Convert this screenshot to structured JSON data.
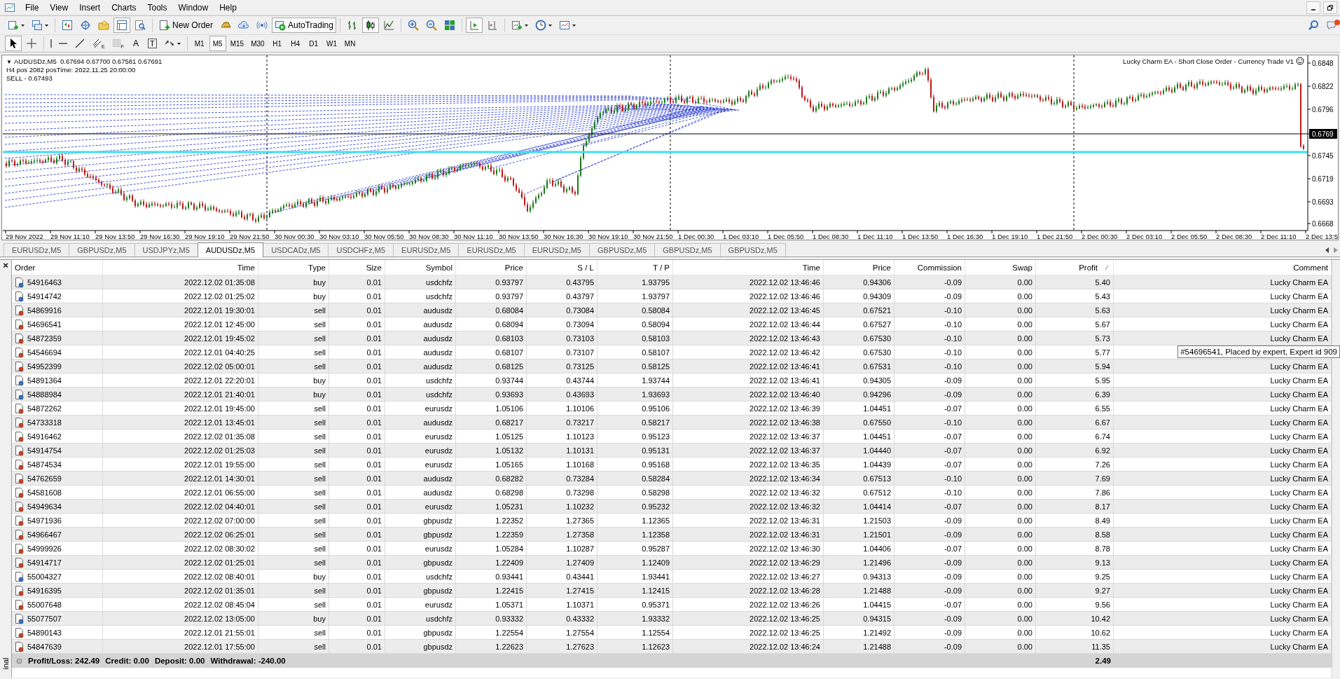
{
  "menu": {
    "items": [
      "File",
      "View",
      "Insert",
      "Charts",
      "Tools",
      "Window",
      "Help"
    ]
  },
  "toolbar": {
    "buttons": [
      {
        "pressed": false
      },
      {
        "pressed": false
      },
      {
        "pressed": false
      },
      {
        "pressed": false
      },
      {
        "pressed": false
      },
      {
        "pressed": true
      },
      {
        "pressed": false
      },
      {
        "label": "New Order",
        "pressed": false
      },
      {
        "pressed": false
      },
      {
        "pressed": false
      },
      {
        "pressed": false
      },
      {
        "label": "AutoTrading",
        "pressed": true
      },
      {
        "pressed": false
      },
      {
        "pressed": true
      },
      {
        "pressed": false
      },
      {
        "pressed": false
      },
      {
        "pressed": false
      },
      {
        "pressed": false
      },
      {
        "pressed": true
      },
      {
        "pressed": false
      },
      {
        "pressed": false
      },
      {
        "pressed": false
      },
      {
        "pressed": false
      }
    ]
  },
  "drawing_toolbar": {
    "tools": [
      {
        "pressed": true
      },
      {
        "pressed": false
      },
      {
        "pressed": false
      },
      {
        "pressed": false
      },
      {
        "pressed": false
      },
      {
        "label": "E",
        "pressed": false
      },
      {
        "label": "F",
        "pressed": false
      },
      {
        "label": "A",
        "pressed": false
      },
      {
        "label": "T",
        "pressed": false
      },
      {
        "pressed": false
      }
    ],
    "timeframes": [
      {
        "label": "M1",
        "selected": false
      },
      {
        "label": "M5",
        "selected": true
      },
      {
        "label": "M15",
        "selected": false
      },
      {
        "label": "M30",
        "selected": false
      },
      {
        "label": "H1",
        "selected": false
      },
      {
        "label": "H4",
        "selected": false
      },
      {
        "label": "D1",
        "selected": false
      },
      {
        "label": "W1",
        "selected": false
      },
      {
        "label": "MN",
        "selected": false
      }
    ]
  },
  "chart": {
    "collapse_arrow": "▼",
    "title": "AUDUSDz,M5  0.67694 0.67700 0.67581 0.67691",
    "info_lines": [
      "H4 pos 2082 posTime: 2022.11.25 20:00:00",
      "SELL - 0.67493"
    ],
    "expert": "Lucky Charm EA - Short Close Order - Currency Trade V1",
    "price_labels": [
      {
        "text": "0.6848",
        "current": false
      },
      {
        "text": "0.6822",
        "current": false
      },
      {
        "text": "0.6796",
        "current": false
      },
      {
        "text": "0.6769",
        "current": true
      },
      {
        "text": "0.6745",
        "current": false
      },
      {
        "text": "0.6719",
        "current": false
      },
      {
        "text": "0.6693",
        "current": false
      },
      {
        "text": "0.6668",
        "current": false
      }
    ],
    "time_labels": [
      "29 Nov 2022",
      "29 Nov 11:10",
      "29 Nov 13:50",
      "29 Nov 16:30",
      "29 Nov 19:10",
      "29 Nov 21:50",
      "30 Nov 00:30",
      "30 Nov 03:10",
      "30 Nov 05:50",
      "30 Nov 08:30",
      "30 Nov 11:10",
      "30 Nov 13:50",
      "30 Nov 16:30",
      "30 Nov 19:10",
      "30 Nov 21:50",
      "1 Dec 00:30",
      "1 Dec 03:10",
      "1 Dec 05:50",
      "1 Dec 08:30",
      "1 Dec 11:10",
      "1 Dec 13:50",
      "1 Dec 16:30",
      "1 Dec 19:10",
      "1 Dec 21:50",
      "2 Dec 00:30",
      "2 Dec 03:10",
      "2 Dec 05:50",
      "2 Dec 08:30",
      "2 Dec 11:10",
      "2 Dec 13:5"
    ]
  },
  "chart_tabs": [
    {
      "label": "EURUSDz,M5",
      "selected": false
    },
    {
      "label": "GBPUSDz,M5",
      "selected": false
    },
    {
      "label": "USDJPYz,M5",
      "selected": false
    },
    {
      "label": "AUDUSDz,M5",
      "selected": true
    },
    {
      "label": "USDCADz,M5",
      "selected": false
    },
    {
      "label": "USDCHFz,M5",
      "selected": false
    },
    {
      "label": "EURUSDz,M5",
      "selected": false
    },
    {
      "label": "EURUSDz,M5",
      "selected": false
    },
    {
      "label": "EURUSDz,M5",
      "selected": false
    },
    {
      "label": "GBPUSDz,M5",
      "selected": false
    },
    {
      "label": "GBPUSDz,M5",
      "selected": false
    },
    {
      "label": "GBPUSDz,M5",
      "selected": false
    }
  ],
  "terminal": {
    "close": "×",
    "side_label": "inal",
    "columns": [
      {
        "label": "Order",
        "sorted": false
      },
      {
        "label": "Time",
        "sorted": false
      },
      {
        "label": "Type",
        "sorted": false
      },
      {
        "label": "Size",
        "sorted": false
      },
      {
        "label": "Symbol",
        "sorted": false
      },
      {
        "label": "Price",
        "sorted": false
      },
      {
        "label": "S / L",
        "sorted": false
      },
      {
        "label": "T / P",
        "sorted": false
      },
      {
        "label": "Time",
        "sorted": false
      },
      {
        "label": "Price",
        "sorted": false
      },
      {
        "label": "Commission",
        "sorted": false
      },
      {
        "label": "Swap",
        "sorted": false
      },
      {
        "label": "Profit",
        "sorted": true
      },
      {
        "label": "Comment",
        "sorted": false
      }
    ],
    "rows": [
      {
        "kind": "buy",
        "cells": [
          "54916463",
          "2022.12.02 01:35:08",
          "buy",
          "0.01",
          "usdchfz",
          "0.93797",
          "0.43795",
          "1.93795",
          "2022.12.02 13:46:46",
          "0.94306",
          "-0.09",
          "0.00",
          "5.40",
          "Lucky Charm EA"
        ]
      },
      {
        "kind": "buy",
        "cells": [
          "54914742",
          "2022.12.02 01:25:02",
          "buy",
          "0.01",
          "usdchfz",
          "0.93797",
          "0.43797",
          "1.93797",
          "2022.12.02 13:46:46",
          "0.94309",
          "-0.09",
          "0.00",
          "5.43",
          "Lucky Charm EA"
        ]
      },
      {
        "kind": "sell",
        "cells": [
          "54869916",
          "2022.12.01 19:30:01",
          "sell",
          "0.01",
          "audusdz",
          "0.68084",
          "0.73084",
          "0.58084",
          "2022.12.02 13:46:45",
          "0.67521",
          "-0.10",
          "0.00",
          "5.63",
          "Lucky Charm EA"
        ]
      },
      {
        "kind": "sell",
        "cells": [
          "54696541",
          "2022.12.01 12:45:00",
          "sell",
          "0.01",
          "audusdz",
          "0.68094",
          "0.73094",
          "0.58094",
          "2022.12.02 13:46:44",
          "0.67527",
          "-0.10",
          "0.00",
          "5.67",
          "Lucky Charm EA"
        ]
      },
      {
        "kind": "sell",
        "cells": [
          "54872359",
          "2022.12.01 19:45:02",
          "sell",
          "0.01",
          "audusdz",
          "0.68103",
          "0.73103",
          "0.58103",
          "2022.12.02 13:46:43",
          "0.67530",
          "-0.10",
          "0.00",
          "5.73",
          "Lucky Charm EA"
        ]
      },
      {
        "kind": "sell",
        "cells": [
          "54546694",
          "2022.12.01 04:40:25",
          "sell",
          "0.01",
          "audusdz",
          "0.68107",
          "0.73107",
          "0.58107",
          "2022.12.02 13:46:42",
          "0.67530",
          "-0.10",
          "0.00",
          "5.77"
        ]
      },
      {
        "kind": "sell",
        "cells": [
          "54952399",
          "2022.12.02 05:00:01",
          "sell",
          "0.01",
          "audusdz",
          "0.68125",
          "0.73125",
          "0.58125",
          "2022.12.02 13:46:41",
          "0.67531",
          "-0.10",
          "0.00",
          "5.94",
          "Lucky Charm EA"
        ]
      },
      {
        "kind": "buy",
        "cells": [
          "54891364",
          "2022.12.01 22:20:01",
          "buy",
          "0.01",
          "usdchfz",
          "0.93744",
          "0.43744",
          "1.93744",
          "2022.12.02 13:46:41",
          "0.94305",
          "-0.09",
          "0.00",
          "5.95",
          "Lucky Charm EA"
        ]
      },
      {
        "kind": "buy",
        "cells": [
          "54888984",
          "2022.12.01 21:40:01",
          "buy",
          "0.01",
          "usdchfz",
          "0.93693",
          "0.43693",
          "1.93693",
          "2022.12.02 13:46:40",
          "0.94296",
          "-0.09",
          "0.00",
          "6.39",
          "Lucky Charm EA"
        ]
      },
      {
        "kind": "sell",
        "cells": [
          "54872262",
          "2022.12.01 19:45:00",
          "sell",
          "0.01",
          "eurusdz",
          "1.05106",
          "1.10106",
          "0.95106",
          "2022.12.02 13:46:39",
          "1.04451",
          "-0.07",
          "0.00",
          "6.55",
          "Lucky Charm EA"
        ]
      },
      {
        "kind": "sell",
        "cells": [
          "54733318",
          "2022.12.01 13:45:01",
          "sell",
          "0.01",
          "audusdz",
          "0.68217",
          "0.73217",
          "0.58217",
          "2022.12.02 13:46:38",
          "0.67550",
          "-0.10",
          "0.00",
          "6.67",
          "Lucky Charm EA"
        ]
      },
      {
        "kind": "sell",
        "cells": [
          "54916462",
          "2022.12.02 01:35:08",
          "sell",
          "0.01",
          "eurusdz",
          "1.05125",
          "1.10123",
          "0.95123",
          "2022.12.02 13:46:37",
          "1.04451",
          "-0.07",
          "0.00",
          "6.74",
          "Lucky Charm EA"
        ]
      },
      {
        "kind": "sell",
        "cells": [
          "54914754",
          "2022.12.02 01:25:03",
          "sell",
          "0.01",
          "eurusdz",
          "1.05132",
          "1.10131",
          "0.95131",
          "2022.12.02 13:46:37",
          "1.04440",
          "-0.07",
          "0.00",
          "6.92",
          "Lucky Charm EA"
        ]
      },
      {
        "kind": "sell",
        "cells": [
          "54874534",
          "2022.12.01 19:55:00",
          "sell",
          "0.01",
          "eurusdz",
          "1.05165",
          "1.10168",
          "0.95168",
          "2022.12.02 13:46:35",
          "1.04439",
          "-0.07",
          "0.00",
          "7.26",
          "Lucky Charm EA"
        ]
      },
      {
        "kind": "sell",
        "cells": [
          "54762659",
          "2022.12.01 14:30:01",
          "sell",
          "0.01",
          "audusdz",
          "0.68282",
          "0.73284",
          "0.58284",
          "2022.12.02 13:46:34",
          "0.67513",
          "-0.10",
          "0.00",
          "7.69",
          "Lucky Charm EA"
        ]
      },
      {
        "kind": "sell",
        "cells": [
          "54581608",
          "2022.12.01 06:55:00",
          "sell",
          "0.01",
          "audusdz",
          "0.68298",
          "0.73298",
          "0.58298",
          "2022.12.02 13:46:32",
          "0.67512",
          "-0.10",
          "0.00",
          "7.86",
          "Lucky Charm EA"
        ]
      },
      {
        "kind": "sell",
        "cells": [
          "54949634",
          "2022.12.02 04:40:01",
          "sell",
          "0.01",
          "eurusdz",
          "1.05231",
          "1.10232",
          "0.95232",
          "2022.12.02 13:46:32",
          "1.04414",
          "-0.07",
          "0.00",
          "8.17",
          "Lucky Charm EA"
        ]
      },
      {
        "kind": "sell",
        "cells": [
          "54971936",
          "2022.12.02 07:00:00",
          "sell",
          "0.01",
          "gbpusdz",
          "1.22352",
          "1.27365",
          "1.12365",
          "2022.12.02 13:46:31",
          "1.21503",
          "-0.09",
          "0.00",
          "8.49",
          "Lucky Charm EA"
        ]
      },
      {
        "kind": "sell",
        "cells": [
          "54966467",
          "2022.12.02 06:25:01",
          "sell",
          "0.01",
          "gbpusdz",
          "1.22359",
          "1.27358",
          "1.12358",
          "2022.12.02 13:46:31",
          "1.21501",
          "-0.09",
          "0.00",
          "8.58",
          "Lucky Charm EA"
        ]
      },
      {
        "kind": "sell",
        "cells": [
          "54999926",
          "2022.12.02 08:30:02",
          "sell",
          "0.01",
          "eurusdz",
          "1.05284",
          "1.10287",
          "0.95287",
          "2022.12.02 13:46:30",
          "1.04406",
          "-0.07",
          "0.00",
          "8.78",
          "Lucky Charm EA"
        ]
      },
      {
        "kind": "sell",
        "cells": [
          "54914717",
          "2022.12.02 01:25:01",
          "sell",
          "0.01",
          "gbpusdz",
          "1.22409",
          "1.27409",
          "1.12409",
          "2022.12.02 13:46:29",
          "1.21496",
          "-0.09",
          "0.00",
          "9.13",
          "Lucky Charm EA"
        ]
      },
      {
        "kind": "buy",
        "cells": [
          "55004327",
          "2022.12.02 08:40:01",
          "buy",
          "0.01",
          "usdchfz",
          "0.93441",
          "0.43441",
          "1.93441",
          "2022.12.02 13:46:27",
          "0.94313",
          "-0.09",
          "0.00",
          "9.25",
          "Lucky Charm EA"
        ]
      },
      {
        "kind": "sell",
        "cells": [
          "54916395",
          "2022.12.02 01:35:01",
          "sell",
          "0.01",
          "gbpusdz",
          "1.22415",
          "1.27415",
          "1.12415",
          "2022.12.02 13:46:28",
          "1.21488",
          "-0.09",
          "0.00",
          "9.27",
          "Lucky Charm EA"
        ]
      },
      {
        "kind": "sell",
        "cells": [
          "55007648",
          "2022.12.02 08:45:04",
          "sell",
          "0.01",
          "eurusdz",
          "1.05371",
          "1.10371",
          "0.95371",
          "2022.12.02 13:46:26",
          "1.04415",
          "-0.07",
          "0.00",
          "9.56",
          "Lucky Charm EA"
        ]
      },
      {
        "kind": "buy",
        "cells": [
          "55077507",
          "2022.12.02 13:05:00",
          "buy",
          "0.01",
          "usdchfz",
          "0.93332",
          "0.43332",
          "1.93332",
          "2022.12.02 13:46:25",
          "0.94315",
          "-0.09",
          "0.00",
          "10.42",
          "Lucky Charm EA"
        ]
      },
      {
        "kind": "sell",
        "cells": [
          "54890143",
          "2022.12.01 21:55:01",
          "sell",
          "0.01",
          "gbpusdz",
          "1.22554",
          "1.27554",
          "1.12554",
          "2022.12.02 13:46:25",
          "1.21492",
          "-0.09",
          "0.00",
          "10.62",
          "Lucky Charm EA"
        ]
      },
      {
        "kind": "sell",
        "cells": [
          "54847639",
          "2022.12.01 17:55:00",
          "sell",
          "0.01",
          "gbpusdz",
          "1.22623",
          "1.27623",
          "1.12623",
          "2022.12.02 13:46:24",
          "1.21488",
          "-0.09",
          "0.00",
          "11.35",
          "Lucky Charm EA"
        ]
      }
    ],
    "summary": [
      "Profit/Loss: 242.49",
      "Credit: 0.00",
      "Deposit: 0.00",
      "Withdrawal: -240.00"
    ],
    "total_profit": "2.49",
    "tooltip": "#54696541, Placed by expert, Expert id 909"
  }
}
